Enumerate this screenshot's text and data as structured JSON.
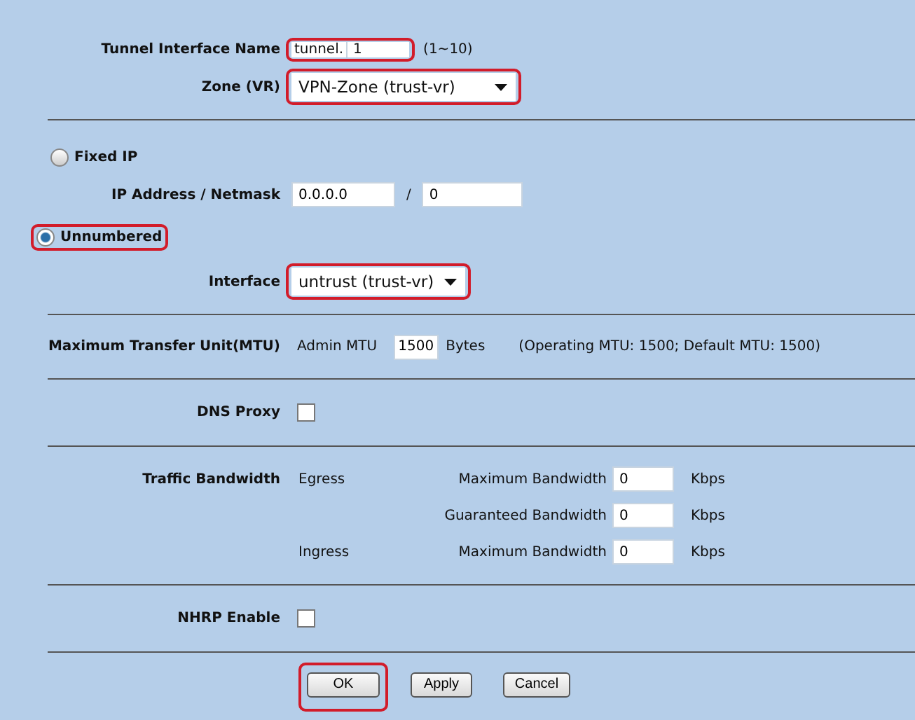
{
  "tunnel_name": {
    "label": "Tunnel Interface Name",
    "prefix": "tunnel.",
    "value": "1",
    "hint": "(1~10)",
    "highlighted": true
  },
  "zone": {
    "label": "Zone (VR)",
    "value": "VPN-Zone (trust-vr)",
    "highlighted": true
  },
  "address_modes": [
    {
      "label": "Fixed IP",
      "selected": false,
      "highlighted": false
    },
    {
      "label": "Unnumbered",
      "selected": true,
      "highlighted": true
    }
  ],
  "ip_address": {
    "label": "IP Address / Netmask",
    "address": "0.0.0.0",
    "separator": "/",
    "netmask": "0"
  },
  "interface": {
    "label": "Interface",
    "value": "untrust (trust-vr)",
    "highlighted": true
  },
  "mtu": {
    "label": "Maximum Transfer Unit(MTU)",
    "field_label": "Admin MTU",
    "value": "1500",
    "unit": "Bytes",
    "note": "(Operating MTU: 1500; Default MTU: 1500)"
  },
  "dns_proxy": {
    "label": "DNS Proxy",
    "checked": false
  },
  "traffic_bandwidth": {
    "label": "Traffic Bandwidth",
    "rows": [
      {
        "direction": "Egress",
        "label": "Maximum Bandwidth",
        "value": "0",
        "unit": "Kbps"
      },
      {
        "label": "Guaranteed Bandwidth",
        "value": "0",
        "unit": "Kbps"
      },
      {
        "direction": "Ingress",
        "label": "Maximum Bandwidth",
        "value": "0",
        "unit": "Kbps"
      }
    ]
  },
  "nhrp": {
    "label": "NHRP Enable",
    "checked": false
  },
  "buttons": [
    {
      "label": "OK",
      "highlighted": true
    },
    {
      "label": "Apply",
      "highlighted": false
    },
    {
      "label": "Cancel",
      "highlighted": false
    }
  ]
}
